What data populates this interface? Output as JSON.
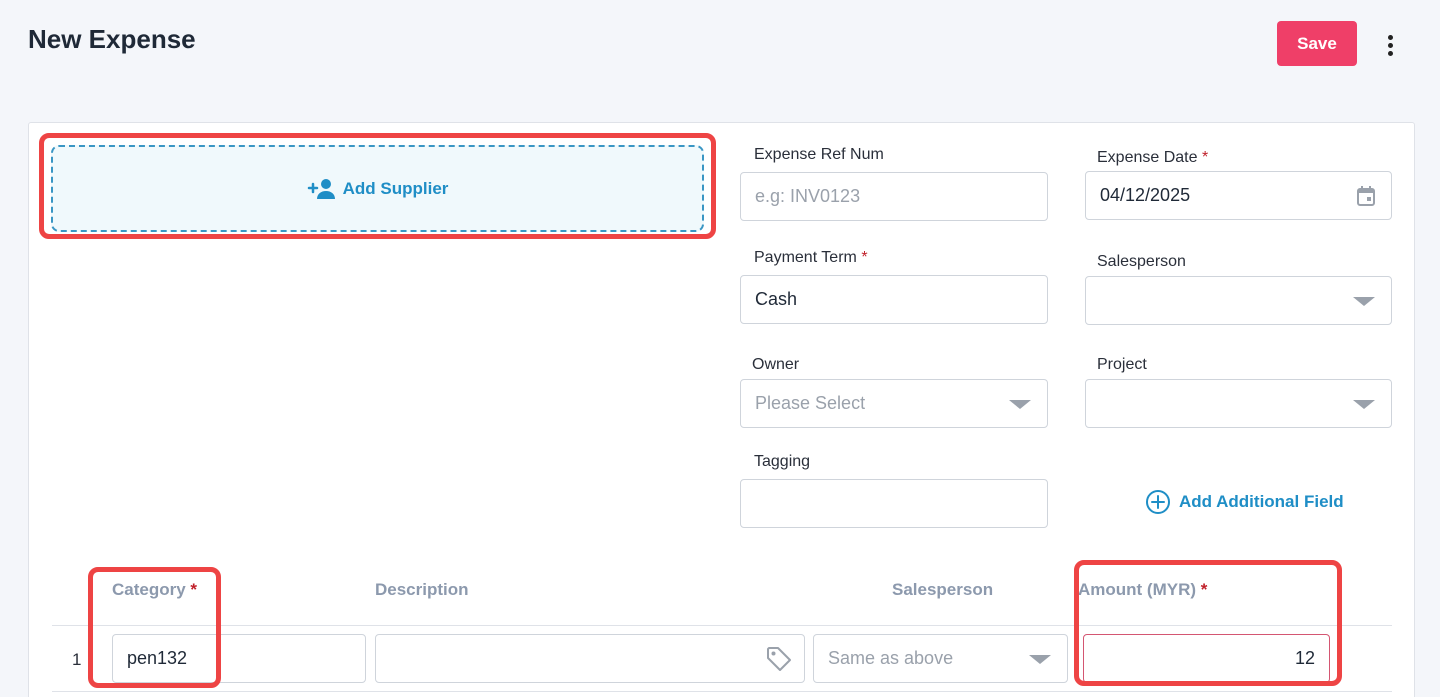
{
  "header": {
    "title": "New Expense",
    "save_label": "Save",
    "more_icon": "more-vertical-icon"
  },
  "supplier": {
    "add_label": "Add Supplier",
    "icon": "add-user-icon"
  },
  "form": {
    "expense_ref_num": {
      "label": "Expense Ref Num",
      "placeholder": "e.g: INV0123",
      "value": ""
    },
    "expense_date": {
      "label": "Expense Date",
      "required": "*",
      "value": "04/12/2025",
      "icon": "calendar-icon"
    },
    "payment_term": {
      "label": "Payment Term",
      "required": "*",
      "value": "Cash"
    },
    "salesperson": {
      "label": "Salesperson",
      "value": ""
    },
    "owner": {
      "label": "Owner",
      "placeholder": "Please Select"
    },
    "project": {
      "label": "Project",
      "value": ""
    },
    "tagging": {
      "label": "Tagging",
      "value": ""
    },
    "add_additional_field": "Add Additional Field"
  },
  "items_table": {
    "columns": {
      "category": "Category",
      "category_required": "*",
      "description": "Description",
      "salesperson": "Salesperson",
      "amount": "Amount (MYR)",
      "amount_required": "*"
    },
    "rows": [
      {
        "num": "1",
        "category": "pen132",
        "description": "",
        "salesperson": "Same as above",
        "amount": "12"
      }
    ]
  },
  "colors": {
    "accent": "#ef3f68",
    "link": "#1f8ec6",
    "highlight": "#ee4444"
  }
}
